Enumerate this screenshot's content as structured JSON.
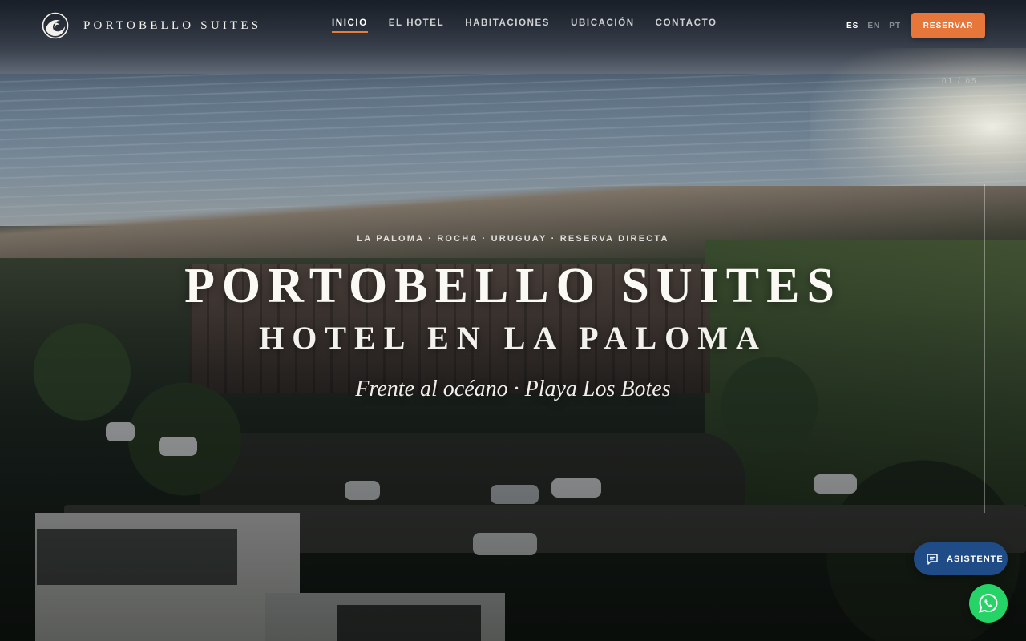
{
  "brand": {
    "name": "PORTOBELLO SUITES",
    "logo_icon": "wave-logo-icon"
  },
  "nav": {
    "items": [
      {
        "label": "INICIO",
        "active": true
      },
      {
        "label": "EL HOTEL",
        "active": false
      },
      {
        "label": "HABITACIONES",
        "active": false
      },
      {
        "label": "UBICACIÓN",
        "active": false
      },
      {
        "label": "CONTACTO",
        "active": false
      }
    ]
  },
  "languages": [
    {
      "code": "ES",
      "active": true
    },
    {
      "code": "EN",
      "active": false
    },
    {
      "code": "PT",
      "active": false
    }
  ],
  "cta": {
    "reserve_label": "RESERVAR",
    "color": "#e6763a"
  },
  "slider": {
    "counter": "01 / 05"
  },
  "hero": {
    "eyebrow": "LA PALOMA · ROCHA · URUGUAY · RESERVA DIRECTA",
    "title": "PORTOBELLO SUITES",
    "subtitle": "HOTEL EN LA PALOMA",
    "tagline": "Frente al océano · Playa Los Botes"
  },
  "floating": {
    "assistant_label": "ASISTENTE",
    "assistant_icon": "chat-icon",
    "assistant_color": "#1f4c86",
    "whatsapp_icon": "whatsapp-icon",
    "whatsapp_color": "#25d366"
  }
}
